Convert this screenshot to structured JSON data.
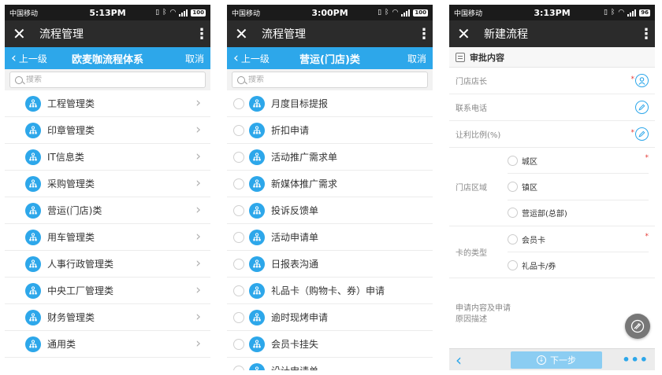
{
  "screens": [
    {
      "status": {
        "carrier": "中国移动",
        "time": "5:13PM",
        "battery": "100"
      },
      "appbar": {
        "title": "流程管理"
      },
      "nav": {
        "back_label": "上一级",
        "title": "欧麦咖流程体系",
        "cancel_label": "取消"
      },
      "search": {
        "placeholder": "搜索"
      },
      "items": [
        "工程管理类",
        "印章管理类",
        "IT信息类",
        "采购管理类",
        "营运(门店)类",
        "用车管理类",
        "人事行政管理类",
        "中央工厂管理类",
        "财务管理类",
        "通用类"
      ]
    },
    {
      "status": {
        "carrier": "中国移动",
        "time": "3:00PM",
        "battery": "100"
      },
      "appbar": {
        "title": "流程管理"
      },
      "nav": {
        "back_label": "上一级",
        "title": "营运(门店)类",
        "cancel_label": "取消"
      },
      "search": {
        "placeholder": "搜索"
      },
      "items": [
        "月度目标提报",
        "折扣申请",
        "活动推广需求单",
        "新媒体推广需求",
        "投诉反馈单",
        "活动申请单",
        "日报表沟通",
        "礼品卡（购物卡、券）申请",
        "逾时现烤申请",
        "会员卡挂失",
        "设计申请单"
      ]
    },
    {
      "status": {
        "carrier": "中国移动",
        "time": "3:13PM",
        "battery": "96"
      },
      "appbar": {
        "title": "新建流程"
      },
      "section": {
        "title": "审批内容"
      },
      "fields": {
        "store_manager": "门店店长",
        "contact_phone": "联系电话",
        "discount_ratio": "让利比例(%)",
        "store_area": {
          "label": "门店区域",
          "options": [
            "城区",
            "镇区",
            "营运部(总部)"
          ]
        },
        "card_type": {
          "label": "卡的类型",
          "options": [
            "会员卡",
            "礼品卡/券"
          ]
        },
        "description": "申请内容及申请原因描述"
      },
      "bottom": {
        "next_label": "下一步"
      }
    }
  ],
  "colors": {
    "accent": "#2da7ea",
    "appbar": "#2b2b2b",
    "statusbar": "#1b1b1b"
  }
}
